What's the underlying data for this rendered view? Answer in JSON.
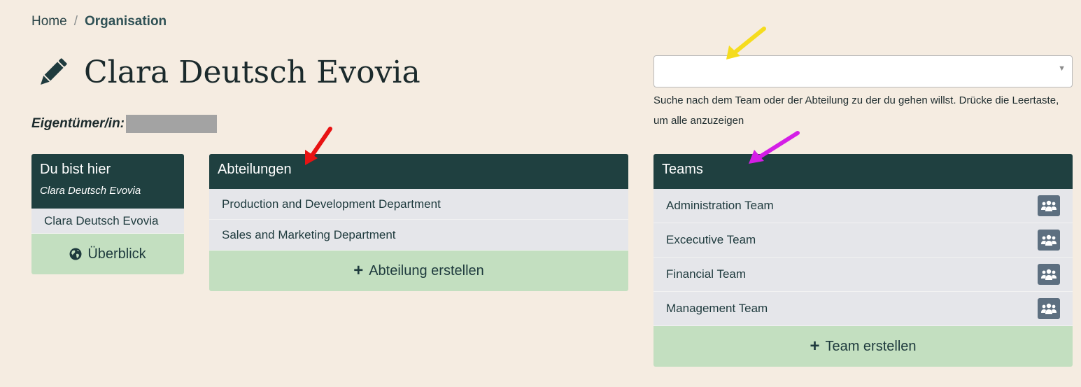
{
  "breadcrumb": {
    "home": "Home",
    "separator": "/",
    "current": "Organisation"
  },
  "page": {
    "title": "Clara Deutsch Evovia",
    "title_icon": "pencil-icon"
  },
  "owner": {
    "label": "Eigentümer/in:"
  },
  "search": {
    "value": "",
    "help": "Suche nach dem Team oder der Abteilung zu der du gehen willst. Drücke die Leertaste, um alle anzuzeigen"
  },
  "you_are_here": {
    "title": "Du bist hier",
    "subtitle": "Clara Deutsch Evovia",
    "items": [
      {
        "label": "Clara Deutsch Evovia"
      }
    ],
    "action": {
      "label": "Überblick",
      "icon": "globe-icon"
    }
  },
  "departments": {
    "title": "Abteilungen",
    "items": [
      {
        "label": "Production and Development Department"
      },
      {
        "label": "Sales and Marketing Department"
      }
    ],
    "action": {
      "label": "Abteilung erstellen",
      "icon": "plus-icon"
    }
  },
  "teams": {
    "title": "Teams",
    "items": [
      {
        "label": "Administration Team",
        "icon": "users-icon"
      },
      {
        "label": "Excecutive Team",
        "icon": "users-icon"
      },
      {
        "label": "Financial Team",
        "icon": "users-icon"
      },
      {
        "label": "Management Team",
        "icon": "users-icon"
      }
    ],
    "action": {
      "label": "Team erstellen",
      "icon": "plus-icon"
    }
  },
  "colors": {
    "background": "#f5ece1",
    "panel_header": "#1f4040",
    "list_row": "#e5e6ea",
    "action_green": "#c3dfc0",
    "team_button": "#5d6f80",
    "arrow_yellow": "#f5dc1e",
    "arrow_red": "#e81313",
    "arrow_magenta": "#d41ee6"
  }
}
